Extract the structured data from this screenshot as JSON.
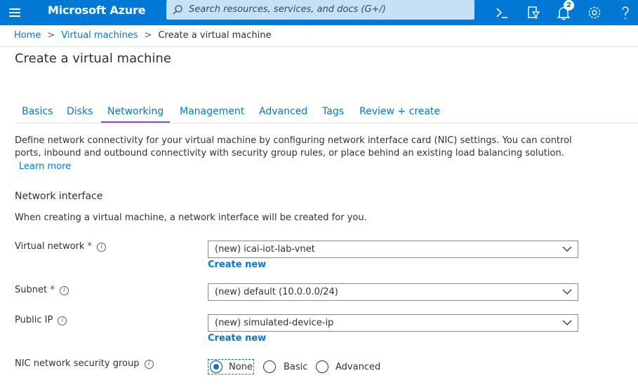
{
  "topbar": {
    "brand": "Microsoft Azure",
    "search_placeholder": "Search resources, services, and docs (G+/)",
    "notification_count": "2",
    "icons": [
      "menu-icon",
      "cloud-shell-icon",
      "directory-filter-icon",
      "notifications-icon",
      "settings-icon",
      "help-icon"
    ]
  },
  "breadcrumb": {
    "items": [
      "Home",
      "Virtual machines",
      "Create a virtual machine"
    ],
    "separator": ">"
  },
  "page": {
    "title": "Create a virtual machine"
  },
  "tabs": [
    "Basics",
    "Disks",
    "Networking",
    "Management",
    "Advanced",
    "Tags",
    "Review + create"
  ],
  "active_tab": "Networking",
  "networking": {
    "description": "Define network connectivity for your virtual machine by configuring network interface card (NIC) settings. You can control ports, inbound and outbound connectivity with security group rules, or place behind an existing load balancing solution.",
    "learn_more": "Learn more",
    "section_title": "Network interface",
    "section_desc": "When creating a virtual machine, a network interface will be created for you.",
    "fields": {
      "virtual_network": {
        "label": "Virtual network",
        "required": "*",
        "value": "(new) icai-iot-lab-vnet",
        "create_new": "Create new"
      },
      "subnet": {
        "label": "Subnet",
        "required": "*",
        "value": "(new) default (10.0.0.0/24)"
      },
      "public_ip": {
        "label": "Public IP",
        "value": "(new) simulated-device-ip",
        "create_new": "Create new"
      },
      "nic_nsg": {
        "label": "NIC network security group",
        "options": [
          "None",
          "Basic",
          "Advanced"
        ],
        "selected": "None"
      }
    },
    "info_glyph": "i"
  },
  "colors": {
    "topbar": "#0078d4",
    "search_bg": "#c7e0f4",
    "link": "#0078d4",
    "tab_underline": "#8a4fb5",
    "required": "#a4262c"
  }
}
